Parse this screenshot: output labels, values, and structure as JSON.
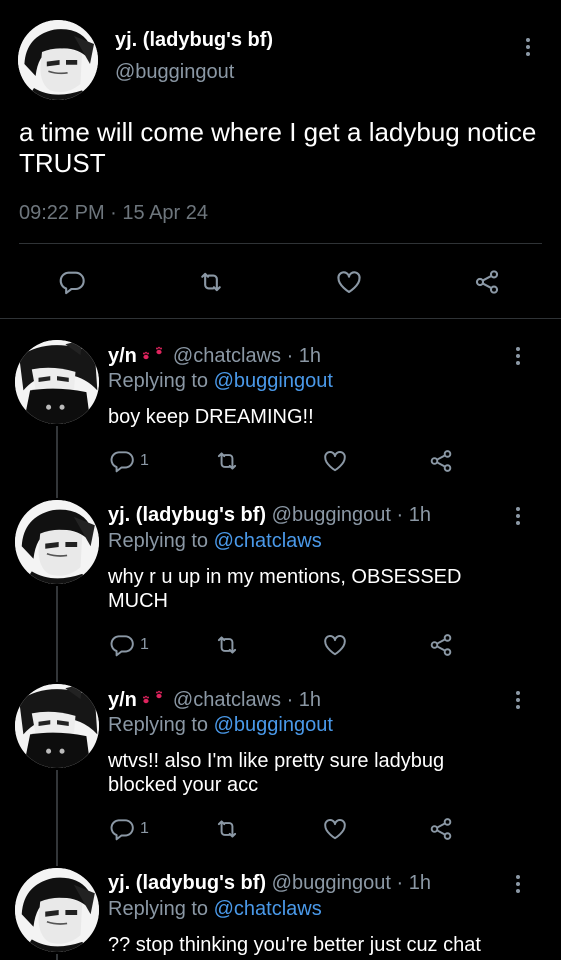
{
  "main_tweet": {
    "display_name": "yj. (ladybug's bf)",
    "handle": "@buggingout",
    "text": "a time will come where I get a ladybug notice TRUST",
    "timestamp": "09:22 PM · 15 Apr 24",
    "actions": [
      "reply-icon",
      "retweet-icon",
      "like-icon",
      "share-icon"
    ]
  },
  "replies": [
    {
      "display_name": "y/n",
      "emoji": "paw-prints-icon",
      "handle_time": "@chatclaws · 1h",
      "replying_prefix": "Replying to",
      "replying_to": "@buggingout",
      "text": "boy keep DREAMING!!",
      "reply_count": "1"
    },
    {
      "display_name": "yj. (ladybug's bf)",
      "handle_time": "@buggingout · 1h",
      "replying_prefix": "Replying to",
      "replying_to": "@chatclaws",
      "text": "why r u up in my mentions, OBSESSED MUCH",
      "reply_count": "1"
    },
    {
      "display_name": "y/n",
      "emoji": "paw-prints-icon",
      "handle_time": "@chatclaws · 1h",
      "replying_prefix": "Replying to",
      "replying_to": "@buggingout",
      "text": "wtvs!! also I'm like pretty sure ladybug blocked your acc",
      "reply_count": "1"
    },
    {
      "display_name": "yj. (ladybug's bf)",
      "handle_time": "@buggingout · 1h",
      "replying_prefix": "Replying to",
      "replying_to": "@chatclaws",
      "text": "?? stop thinking you're better just cuz chat"
    }
  ],
  "colors": {
    "background": "#000000",
    "text": "#e7e9ea",
    "muted": "#8b98a5",
    "link": "#4a99e9",
    "paw": "#e0245e"
  }
}
